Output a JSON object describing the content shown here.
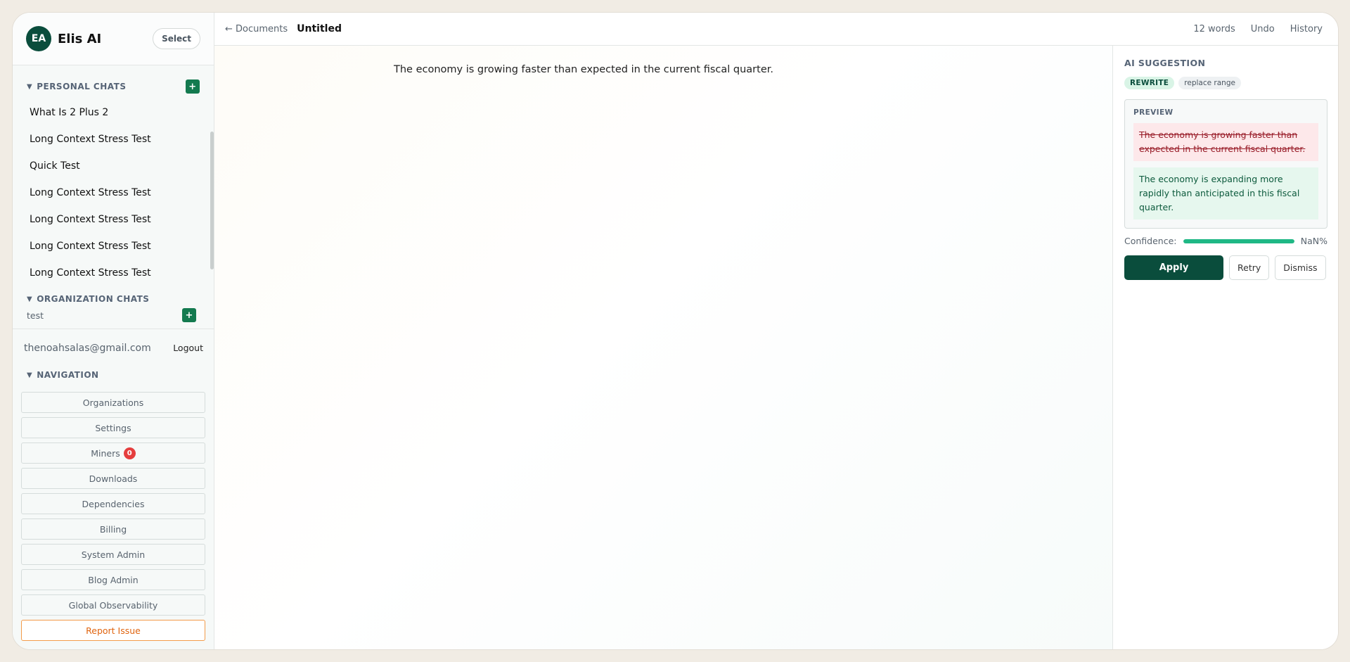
{
  "sidebar": {
    "avatar_initials": "EA",
    "brand": "Elis AI",
    "select_label": "Select",
    "personal_chats": {
      "title": "PERSONAL CHATS",
      "items": [
        "What Is 2 Plus 2",
        "Long Context Stress Test",
        "Quick Test",
        "Long Context Stress Test",
        "Long Context Stress Test",
        "Long Context Stress Test",
        "Long Context Stress Test"
      ]
    },
    "organization_chats": {
      "title": "ORGANIZATION CHATS",
      "items": [
        "test"
      ]
    },
    "account": {
      "email": "thenoahsalas@gmail.com",
      "logout_label": "Logout"
    },
    "navigation": {
      "title": "NAVIGATION",
      "items": [
        "Organizations",
        "Settings",
        "Miners",
        "Downloads",
        "Dependencies",
        "Billing",
        "System Admin",
        "Blog Admin",
        "Global Observability",
        "Report Issue"
      ],
      "miners_badge": "0"
    }
  },
  "topbar": {
    "back_label": "← Documents",
    "doc_title": "Untitled",
    "word_count": "12 words",
    "undo_label": "Undo",
    "history_label": "History"
  },
  "editor": {
    "text": "The economy is growing faster than expected in the current fiscal quarter."
  },
  "ai_suggestion": {
    "title": "AI SUGGESTION",
    "type_tag": "REWRITE",
    "scope_tag": "replace range",
    "preview_label": "PREVIEW",
    "old_text": "The economy is growing faster than expected in the current fiscal quarter.",
    "new_text": "The economy is expanding more rapidly than anticipated in this fiscal quarter.",
    "confidence_label": "Confidence:",
    "confidence_value": "NaN%",
    "confidence_fill": 1.0,
    "apply_label": "Apply",
    "retry_label": "Retry",
    "dismiss_label": "Dismiss"
  },
  "colors": {
    "brand_green": "#0a4d3c",
    "accent_green": "#1fb885",
    "danger_red": "#e53e3e",
    "report_orange": "#e0640f"
  }
}
